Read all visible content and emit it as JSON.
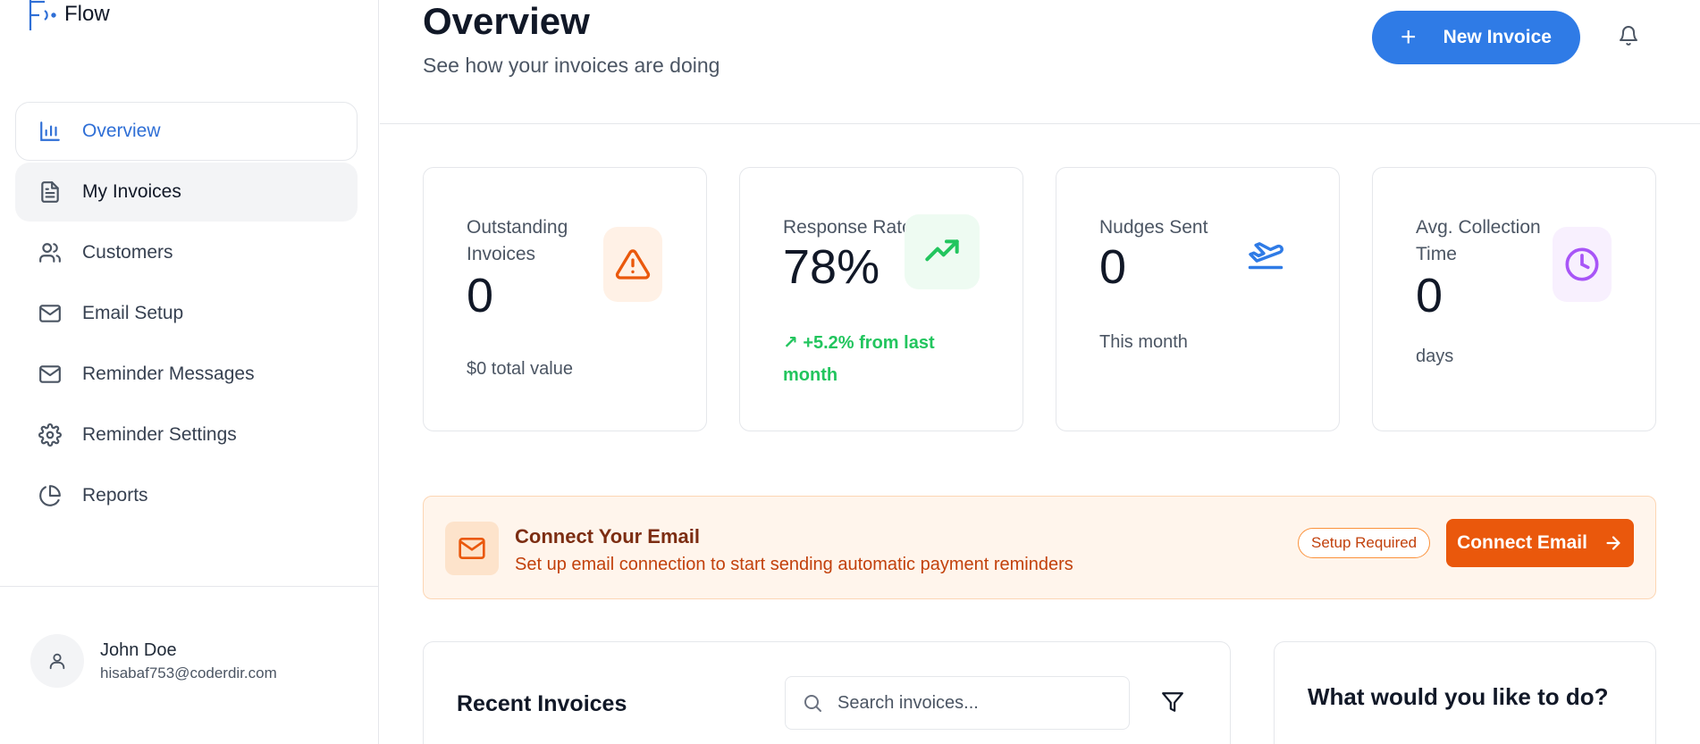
{
  "app": {
    "name": "Flow"
  },
  "sidebar": {
    "items": [
      {
        "label": "Overview",
        "icon": "bar-chart-icon"
      },
      {
        "label": "My Invoices",
        "icon": "file-text-icon"
      },
      {
        "label": "Customers",
        "icon": "users-icon"
      },
      {
        "label": "Email Setup",
        "icon": "mail-icon"
      },
      {
        "label": "Reminder Messages",
        "icon": "mail-icon"
      },
      {
        "label": "Reminder Settings",
        "icon": "gear-icon"
      },
      {
        "label": "Reports",
        "icon": "pie-chart-icon"
      }
    ],
    "active_index": 0
  },
  "user": {
    "name": "John Doe",
    "email": "hisabaf753@coderdir.com"
  },
  "header": {
    "title": "Overview",
    "subtitle": "See how your invoices are doing",
    "new_invoice_label": "New Invoice",
    "new_invoice_symbol": "+"
  },
  "stats": [
    {
      "label": "Outstanding Invoices",
      "value": "0",
      "sub": "$0 total value",
      "icon": "alert-triangle-icon",
      "color": "#ea580c",
      "bg": "#fff1e6"
    },
    {
      "label": "Response Rate",
      "value": "78%",
      "trend": "↗ +5.2% from last month",
      "icon": "trending-up-icon",
      "color": "#22c55e",
      "bg": "#eefbf2"
    },
    {
      "label": "Nudges Sent",
      "value": "0",
      "sub": "This month",
      "icon": "plane-departure-icon",
      "color": "#2f7be6",
      "bg": "#ffffff"
    },
    {
      "label": "Avg. Collection Time",
      "value": "0",
      "sub": "days",
      "icon": "clock-icon",
      "color": "#a855f7",
      "bg": "#f8f0fe"
    }
  ],
  "banner": {
    "title": "Connect Your Email",
    "description": "Set up email connection to start sending automatic payment reminders",
    "badge": "Setup Required",
    "button_label": "Connect Email"
  },
  "recent_invoices": {
    "title": "Recent Invoices",
    "search_placeholder": "Search invoices..."
  },
  "actions_panel": {
    "title": "What would you like to do?"
  },
  "colors": {
    "primary": "#2f7be6",
    "accent_orange": "#ea580c",
    "success": "#22c55e",
    "purple": "#a855f7"
  }
}
